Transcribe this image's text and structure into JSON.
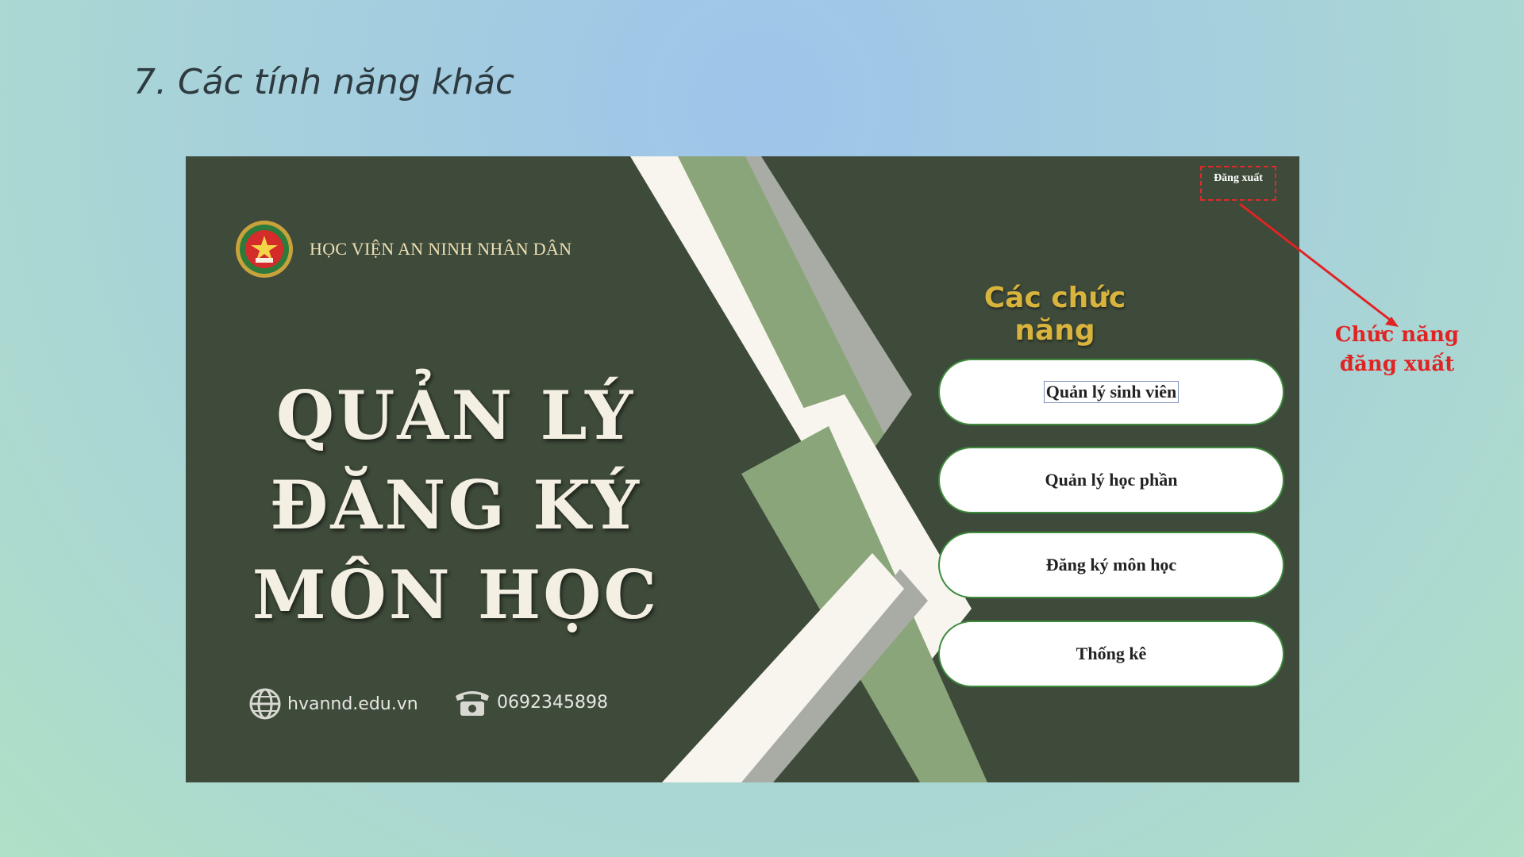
{
  "slide": {
    "title": "7. Các tính năng khác"
  },
  "app": {
    "brand_name": "HỌC VIỆN AN NINH NHÂN DÂN",
    "hero_lines": [
      "QUẢN LÝ",
      "ĐĂNG KÝ",
      "MÔN HỌC"
    ],
    "website": "hvannd.edu.vn",
    "phone": "0692345898",
    "logout_label": "Đăng xuất",
    "functions_heading": "Các chức năng",
    "function_buttons": [
      {
        "label": "Quản lý sinh viên",
        "selected": true
      },
      {
        "label": "Quản lý học phần",
        "selected": false
      },
      {
        "label": "Đăng ký môn học",
        "selected": false
      },
      {
        "label": "Thống kê",
        "selected": false
      }
    ]
  },
  "annotation": {
    "lines": [
      "Chức năng",
      "đăng xuất"
    ]
  },
  "colors": {
    "window_bg": "#3e4a3a",
    "accent_gold": "#d9b43d",
    "stripe_green": "#8aa57a",
    "annotation_red": "#e02424",
    "button_border": "#3d8b3d"
  },
  "icons": [
    "emblem-logo-icon",
    "globe-icon",
    "telephone-icon",
    "arrow-annotation-icon"
  ]
}
